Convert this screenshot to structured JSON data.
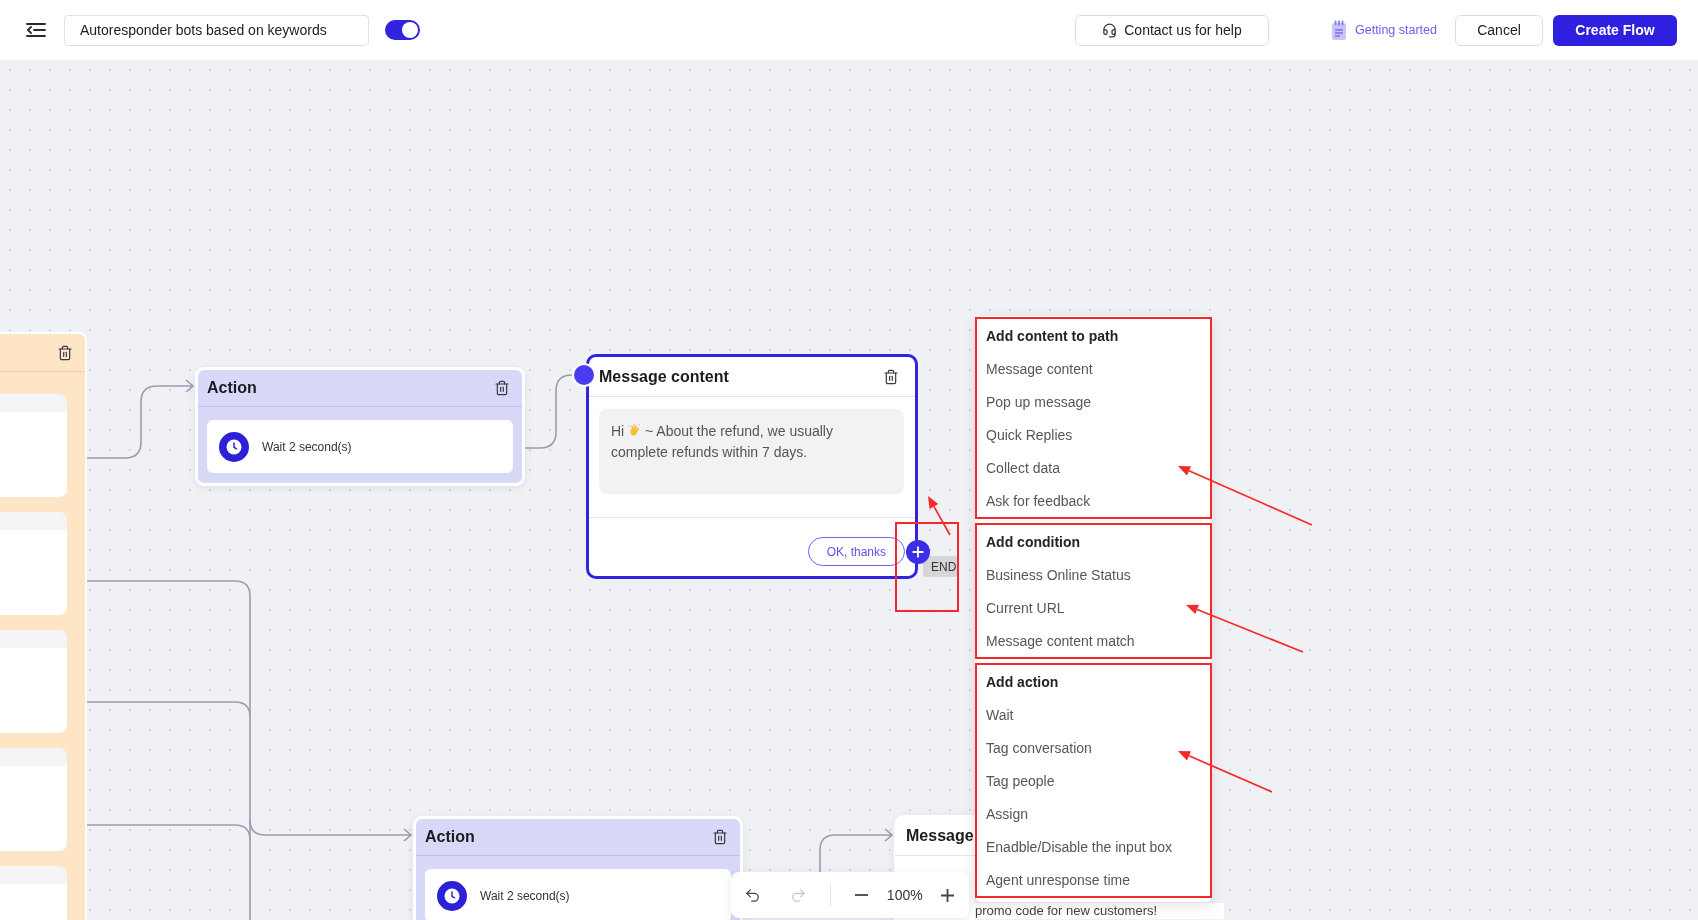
{
  "header": {
    "flow_name": "Autoresponder bots based on keywords",
    "flow_enabled": true,
    "help_button": "Contact us for help",
    "guide_link": "Getting started",
    "cancel_button": "Cancel",
    "create_button": "Create Flow"
  },
  "canvas": {
    "nodes": [
      {
        "kind": "trigger"
      },
      {
        "kind": "action",
        "title": "Action",
        "steps": [
          {
            "kind": "wait",
            "text": "Wait 2 second(s)"
          }
        ]
      },
      {
        "kind": "message",
        "title": "Message content",
        "selected": true,
        "greeting": "Hi",
        "text": "~ About the refund, we usually complete refunds within 7 days.",
        "quick_replies": [
          "OK, thanks"
        ],
        "end_label": "END",
        "add_highlighted": true
      },
      {
        "kind": "action",
        "title": "Action",
        "steps": [
          {
            "kind": "wait",
            "text": "Wait 2 second(s)"
          }
        ]
      },
      {
        "kind": "message",
        "title": "Message",
        "selected": false,
        "text": "promo code for new customers!"
      }
    ]
  },
  "add_menu": {
    "sections": [
      {
        "title": "Add content to path",
        "highlighted": true,
        "items": [
          "Message content",
          "Pop up message",
          "Quick Replies",
          "Collect data",
          "Ask for feedback"
        ]
      },
      {
        "title": "Add condition",
        "highlighted": true,
        "items": [
          "Business Online Status",
          "Current URL",
          "Message content match"
        ]
      },
      {
        "title": "Add action",
        "highlighted": true,
        "items": [
          "Wait",
          "Tag conversation",
          "Tag people",
          "Assign",
          "Enadble/Disable the input box",
          "Agent unresponse time"
        ]
      }
    ]
  },
  "zoom_controls": {
    "undo_disabled": false,
    "redo_disabled": true,
    "zoom": "100%"
  }
}
